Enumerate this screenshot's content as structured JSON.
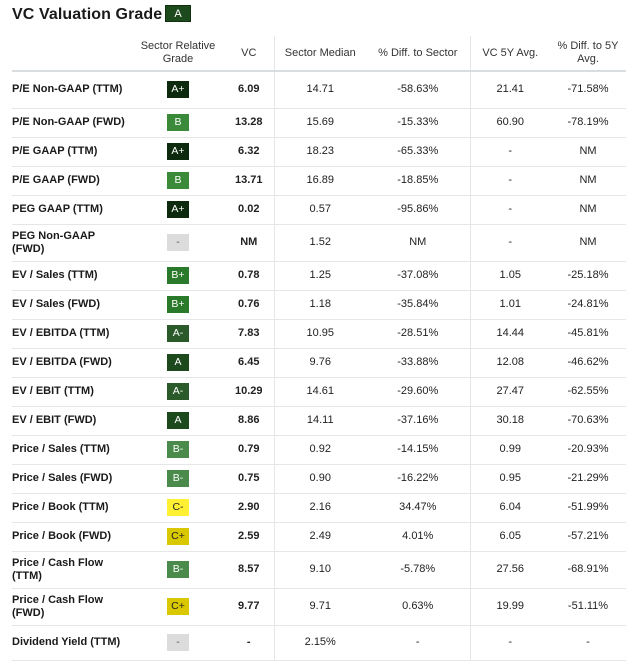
{
  "header": {
    "title": "VC Valuation Grade",
    "overall_grade": "A"
  },
  "grade_colors": {
    "A+": {
      "bg": "#0e2a0e",
      "fg": "#ffffff"
    },
    "A": {
      "bg": "#1d4a1d",
      "fg": "#ffffff"
    },
    "A-": {
      "bg": "#2a5a2a",
      "fg": "#ffffff"
    },
    "B+": {
      "bg": "#2b7a2b",
      "fg": "#ffffff"
    },
    "B": {
      "bg": "#3a8a3a",
      "fg": "#ffffff"
    },
    "B-": {
      "bg": "#4a8a4a",
      "fg": "#ffffff"
    },
    "C+": {
      "bg": "#d9c800",
      "fg": "#222222"
    },
    "C-": {
      "bg": "#fff033",
      "fg": "#222222"
    },
    "-": {
      "bg": "#dcdcdc",
      "fg": "#555555"
    }
  },
  "table": {
    "columns": [
      "",
      "Sector Relative Grade",
      "VC",
      "Sector Median",
      "% Diff. to Sector",
      "VC 5Y Avg.",
      "% Diff. to 5Y Avg."
    ],
    "rows": [
      {
        "metric": "P/E Non-GAAP (TTM)",
        "grade": "A+",
        "vc": "6.09",
        "sector_median": "14.71",
        "diff_sector": "-58.63%",
        "avg_5y": "21.41",
        "diff_5y": "-71.58%"
      },
      {
        "metric": "P/E Non-GAAP (FWD)",
        "grade": "B",
        "vc": "13.28",
        "sector_median": "15.69",
        "diff_sector": "-15.33%",
        "avg_5y": "60.90",
        "diff_5y": "-78.19%"
      },
      {
        "metric": "P/E GAAP (TTM)",
        "grade": "A+",
        "vc": "6.32",
        "sector_median": "18.23",
        "diff_sector": "-65.33%",
        "avg_5y": "-",
        "diff_5y": "NM"
      },
      {
        "metric": "P/E GAAP (FWD)",
        "grade": "B",
        "vc": "13.71",
        "sector_median": "16.89",
        "diff_sector": "-18.85%",
        "avg_5y": "-",
        "diff_5y": "NM"
      },
      {
        "metric": "PEG GAAP (TTM)",
        "grade": "A+",
        "vc": "0.02",
        "sector_median": "0.57",
        "diff_sector": "-95.86%",
        "avg_5y": "-",
        "diff_5y": "NM"
      },
      {
        "metric": "PEG Non-GAAP (FWD)",
        "grade": "-",
        "vc": "NM",
        "sector_median": "1.52",
        "diff_sector": "NM",
        "avg_5y": "-",
        "diff_5y": "NM"
      },
      {
        "metric": "EV / Sales (TTM)",
        "grade": "B+",
        "vc": "0.78",
        "sector_median": "1.25",
        "diff_sector": "-37.08%",
        "avg_5y": "1.05",
        "diff_5y": "-25.18%"
      },
      {
        "metric": "EV / Sales (FWD)",
        "grade": "B+",
        "vc": "0.76",
        "sector_median": "1.18",
        "diff_sector": "-35.84%",
        "avg_5y": "1.01",
        "diff_5y": "-24.81%"
      },
      {
        "metric": "EV / EBITDA (TTM)",
        "grade": "A-",
        "vc": "7.83",
        "sector_median": "10.95",
        "diff_sector": "-28.51%",
        "avg_5y": "14.44",
        "diff_5y": "-45.81%"
      },
      {
        "metric": "EV / EBITDA (FWD)",
        "grade": "A",
        "vc": "6.45",
        "sector_median": "9.76",
        "diff_sector": "-33.88%",
        "avg_5y": "12.08",
        "diff_5y": "-46.62%"
      },
      {
        "metric": "EV / EBIT (TTM)",
        "grade": "A-",
        "vc": "10.29",
        "sector_median": "14.61",
        "diff_sector": "-29.60%",
        "avg_5y": "27.47",
        "diff_5y": "-62.55%"
      },
      {
        "metric": "EV / EBIT (FWD)",
        "grade": "A",
        "vc": "8.86",
        "sector_median": "14.11",
        "diff_sector": "-37.16%",
        "avg_5y": "30.18",
        "diff_5y": "-70.63%"
      },
      {
        "metric": "Price / Sales (TTM)",
        "grade": "B-",
        "vc": "0.79",
        "sector_median": "0.92",
        "diff_sector": "-14.15%",
        "avg_5y": "0.99",
        "diff_5y": "-20.93%"
      },
      {
        "metric": "Price / Sales (FWD)",
        "grade": "B-",
        "vc": "0.75",
        "sector_median": "0.90",
        "diff_sector": "-16.22%",
        "avg_5y": "0.95",
        "diff_5y": "-21.29%"
      },
      {
        "metric": "Price / Book (TTM)",
        "grade": "C-",
        "vc": "2.90",
        "sector_median": "2.16",
        "diff_sector": "34.47%",
        "avg_5y": "6.04",
        "diff_5y": "-51.99%"
      },
      {
        "metric": "Price / Book (FWD)",
        "grade": "C+",
        "vc": "2.59",
        "sector_median": "2.49",
        "diff_sector": "4.01%",
        "avg_5y": "6.05",
        "diff_5y": "-57.21%"
      },
      {
        "metric": "Price / Cash Flow (TTM)",
        "grade": "B-",
        "vc": "8.57",
        "sector_median": "9.10",
        "diff_sector": "-5.78%",
        "avg_5y": "27.56",
        "diff_5y": "-68.91%"
      },
      {
        "metric": "Price / Cash Flow (FWD)",
        "grade": "C+",
        "vc": "9.77",
        "sector_median": "9.71",
        "diff_sector": "0.63%",
        "avg_5y": "19.99",
        "diff_5y": "-51.11%"
      },
      {
        "metric": "Dividend Yield (TTM)",
        "grade": "-",
        "vc": "-",
        "sector_median": "2.15%",
        "diff_sector": "-",
        "avg_5y": "-",
        "diff_5y": "-"
      }
    ]
  }
}
